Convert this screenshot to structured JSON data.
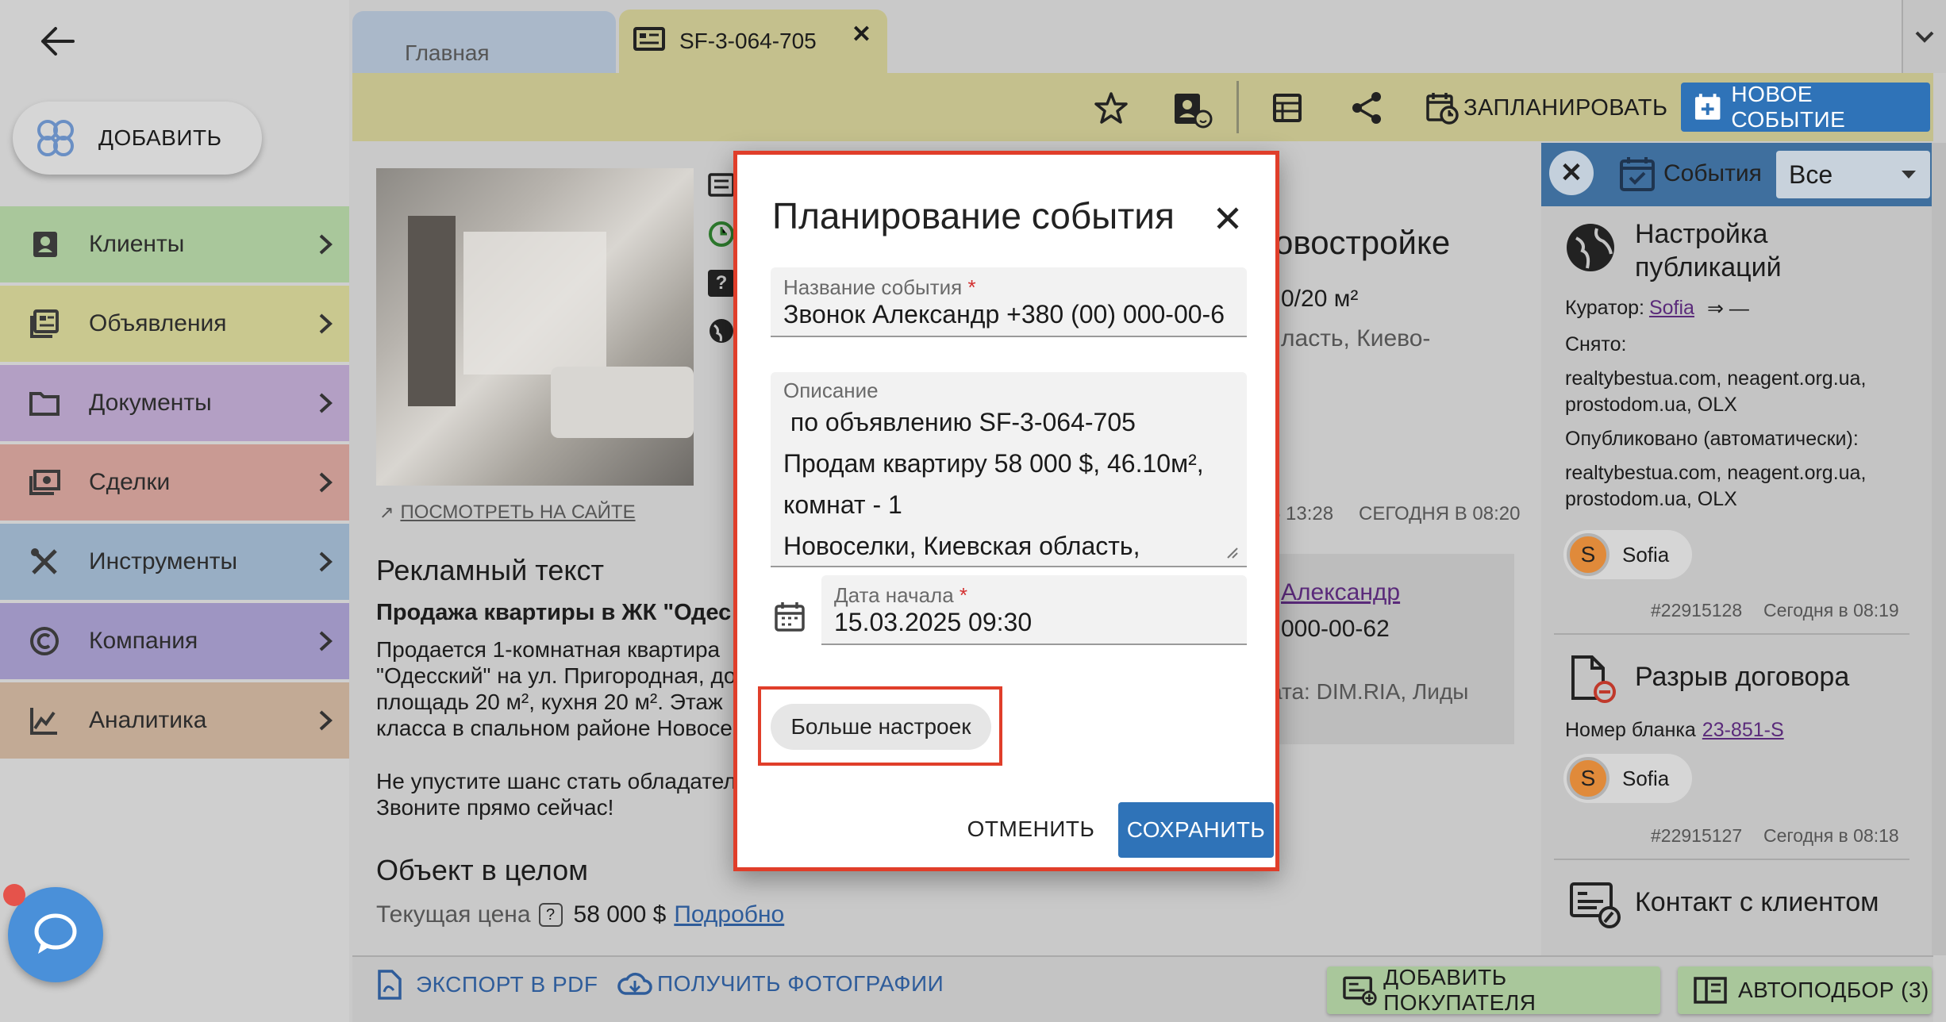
{
  "sidebar": {
    "add_label": "ДОБАВИТЬ",
    "items": [
      {
        "label": "Клиенты",
        "color": "#a9c79b"
      },
      {
        "label": "Объявления",
        "color": "#c9c88f"
      },
      {
        "label": "Документы",
        "color": "#b39fc4"
      },
      {
        "label": "Сделки",
        "color": "#c99a93"
      },
      {
        "label": "Инструменты",
        "color": "#98aec4"
      },
      {
        "label": "Компания",
        "color": "#9e95c2"
      },
      {
        "label": "Аналитика",
        "color": "#c2aa95"
      }
    ]
  },
  "tabs": [
    {
      "label": "Главная"
    },
    {
      "label": "SF-3-064-705"
    }
  ],
  "toolbar": {
    "schedule_label": "ЗАПЛАНИРОВАТЬ",
    "new_event_label": "НОВОЕ СОБЫТИЕ"
  },
  "listing": {
    "view_on_site": "ПОСМОТРЕТЬ НА САЙТЕ",
    "title_fragment": "овостройке",
    "area_fragment": "0/20 м²",
    "location_fragment": "ласть, Киево-",
    "time1": "5 13:28",
    "time2": "СЕГОДНЯ В 08:20",
    "ad_text_heading": "Рекламный текст",
    "ad_title": "Продажа квартиры в ЖК \"Одес",
    "ad_lines": [
      "Продается 1-комнатная квартира",
      "\"Одесский\" на ул. Пригородная, до",
      "площадь 20 м², кухня 20 м². Этаж",
      "класса в спальном районе Новосе"
    ],
    "ad_cta1": "Не упустите шанс стать обладател",
    "ad_cta2": "Звоните прямо сейчас!",
    "object_heading": "Объект в целом",
    "price_label": "Текущая цена",
    "price_value": "58 000 $",
    "price_link": "Подробно",
    "contact_link": "Александр",
    "contact_phone": "000-00-62",
    "source": "ата: DIM.RIA, Лиды"
  },
  "bottom": {
    "export_pdf": "ЭКСПОРТ В PDF",
    "get_photos": "ПОЛУЧИТЬ ФОТОГРАФИИ",
    "add_buyer": "ДОБАВИТЬ ПОКУПАТЕЛЯ",
    "autoselect": "АВТОПОДБОР (3)"
  },
  "events_panel": {
    "title": "События",
    "filter": "Все",
    "events": [
      {
        "title1": "Настройка",
        "title2": "публикаций",
        "curator_label": "Куратор:",
        "curator": "Sofia",
        "arrow": "⇒ —",
        "removed_label": "Снято:",
        "removed_sites1": "realtybestua.com, neagent.org.ua,",
        "removed_sites2": "prostodom.ua, OLX",
        "published_label": "Опубликовано (автоматически):",
        "published_sites1": "realtybestua.com, neagent.org.ua,",
        "published_sites2": "prostodom.ua, OLX",
        "user": "Sofia",
        "id": "#22915128",
        "time": "Сегодня в 08:19"
      },
      {
        "title1": "Разрыв договора",
        "blank_label": "Номер бланка",
        "blank_number": "23-851-S",
        "user": "Sofia",
        "id": "#22915127",
        "time": "Сегодня в 08:18"
      },
      {
        "title1": "Контакт с клиентом"
      }
    ]
  },
  "dialog": {
    "title": "Планирование события",
    "name_label": "Название события",
    "name_value": "Звонок Александр +380 (00) 000-00-6",
    "desc_label": "Описание",
    "desc_lines": [
      " по объявлению SF-3-064-705",
      "Продам квартиру 58 000 $, 46.10м²,",
      "комнат - 1",
      "Новоселки, Киевская область,"
    ],
    "date_label": "Дата начала",
    "date_value": "15.03.2025 09:30",
    "more_settings": "Больше настроек",
    "cancel": "ОТМЕНИТЬ",
    "save": "СОХРАНИТЬ"
  },
  "avatar_letter": "S",
  "required_mark": "*",
  "colors": {
    "accent": "#2f73b8",
    "highlight": "#e03e2a",
    "toolbar": "#c4c08d",
    "chat": "#4a90d9"
  }
}
